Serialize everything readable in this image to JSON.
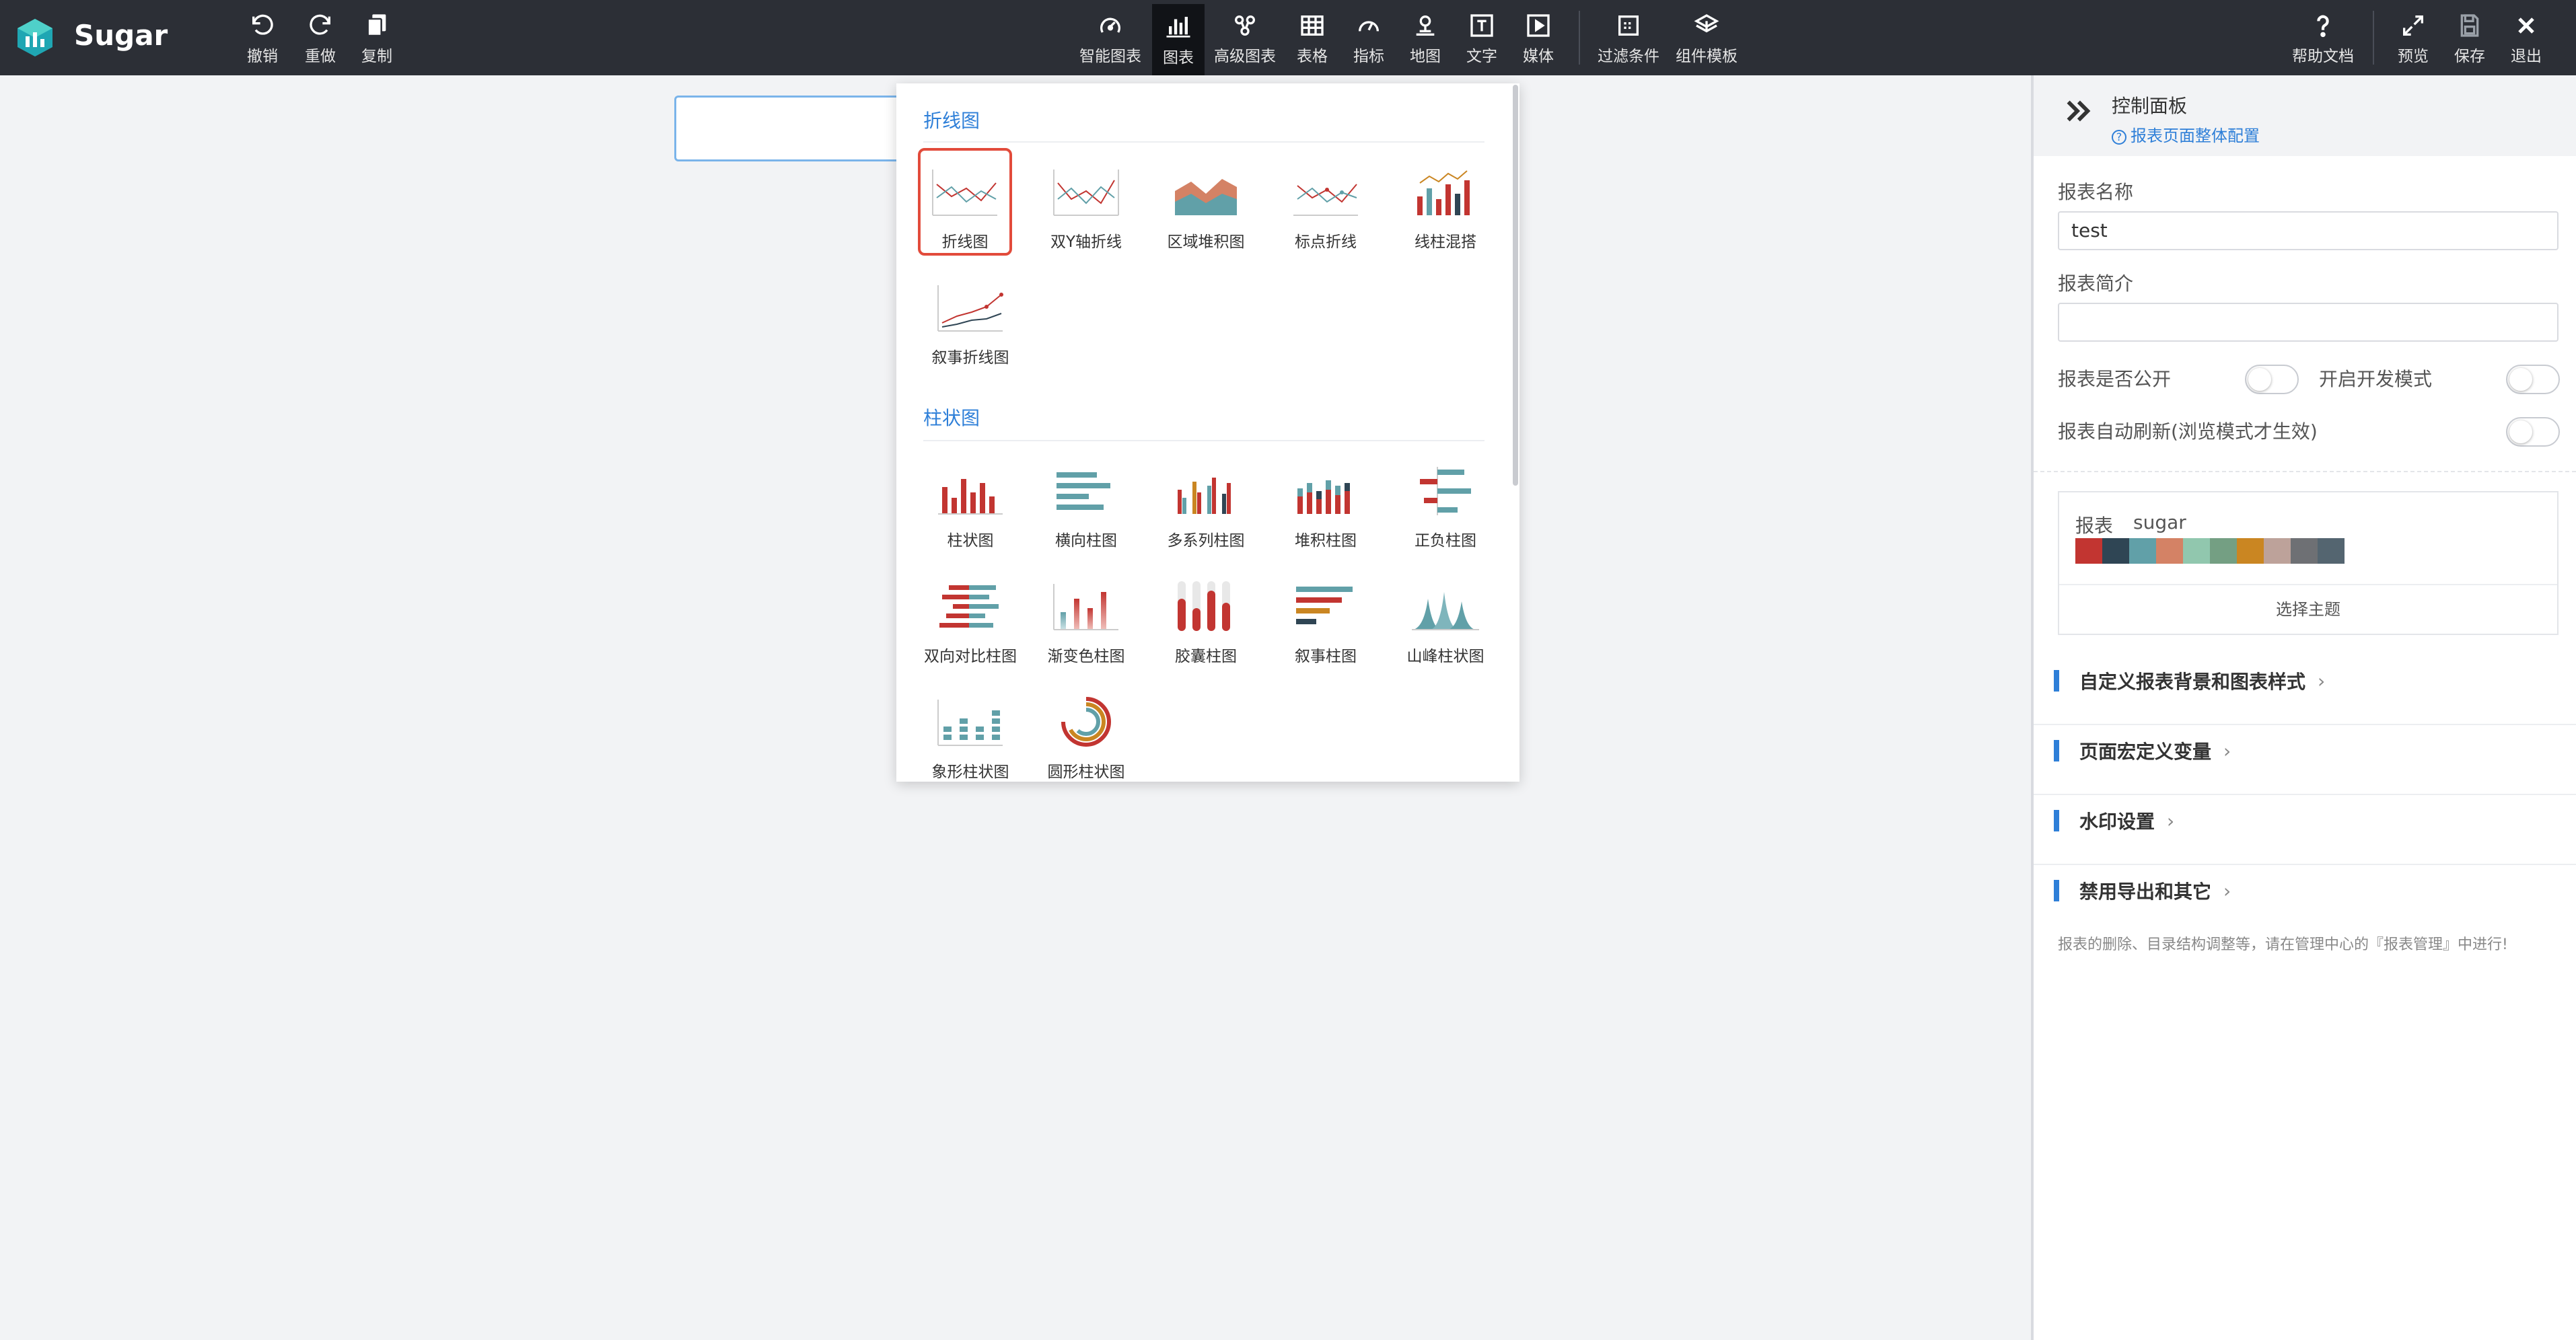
{
  "app": {
    "brand": "Sugar"
  },
  "toolbar": {
    "left": [
      {
        "label": "撤销",
        "icon": "undo-icon"
      },
      {
        "label": "重做",
        "icon": "redo-icon"
      },
      {
        "label": "复制",
        "icon": "copy-icon"
      }
    ],
    "center": [
      {
        "label": "智能图表",
        "icon": "smart-chart-icon"
      },
      {
        "label": "图表",
        "icon": "chart-icon",
        "active": true
      },
      {
        "label": "高级图表",
        "icon": "advanced-chart-icon"
      },
      {
        "label": "表格",
        "icon": "table-icon"
      },
      {
        "label": "指标",
        "icon": "gauge-icon"
      },
      {
        "label": "地图",
        "icon": "map-pin-icon"
      },
      {
        "label": "文字",
        "icon": "text-icon"
      },
      {
        "label": "媒体",
        "icon": "media-icon"
      },
      {
        "label": "过滤条件",
        "icon": "filter-icon"
      },
      {
        "label": "组件模板",
        "icon": "template-icon"
      }
    ],
    "right": [
      {
        "label": "帮助文档",
        "icon": "help-icon"
      },
      {
        "label": "预览",
        "icon": "expand-icon"
      },
      {
        "label": "保存",
        "icon": "save-icon"
      },
      {
        "label": "退出",
        "icon": "close-icon"
      }
    ]
  },
  "chart_menu": {
    "sections": [
      {
        "title": "折线图",
        "items": [
          {
            "label": "折线图",
            "icon": "line-chart-icon",
            "selected": true
          },
          {
            "label": "双Y轴折线",
            "icon": "dual-y-line-icon"
          },
          {
            "label": "区域堆积图",
            "icon": "stacked-area-icon"
          },
          {
            "label": "标点折线",
            "icon": "marker-line-icon"
          },
          {
            "label": "线柱混搭",
            "icon": "line-bar-combo-icon"
          },
          {
            "label": "叙事折线图",
            "icon": "narrative-line-icon"
          }
        ]
      },
      {
        "title": "柱状图",
        "items": [
          {
            "label": "柱状图",
            "icon": "bar-chart-icon"
          },
          {
            "label": "横向柱图",
            "icon": "horizontal-bar-icon"
          },
          {
            "label": "多系列柱图",
            "icon": "multi-series-bar-icon"
          },
          {
            "label": "堆积柱图",
            "icon": "stacked-bar-icon"
          },
          {
            "label": "正负柱图",
            "icon": "pos-neg-bar-icon"
          },
          {
            "label": "双向对比柱图",
            "icon": "bidirectional-bar-icon"
          },
          {
            "label": "渐变色柱图",
            "icon": "gradient-bar-icon"
          },
          {
            "label": "胶囊柱图",
            "icon": "capsule-bar-icon"
          },
          {
            "label": "叙事柱图",
            "icon": "narrative-bar-icon"
          },
          {
            "label": "山峰柱状图",
            "icon": "peak-bar-icon"
          },
          {
            "label": "象形柱状图",
            "icon": "pictorial-bar-icon"
          },
          {
            "label": "圆形柱状图",
            "icon": "radial-bar-icon"
          }
        ]
      }
    ]
  },
  "panel": {
    "title": "控制面板",
    "help_link": "报表页面整体配置",
    "name_label": "报表名称",
    "name_value": "test",
    "desc_label": "报表简介",
    "desc_value": "",
    "public_label": "报表是否公开",
    "dev_label": "开启开发模式",
    "refresh_label": "报表自动刷新(浏览模式才生效)",
    "theme": {
      "label": "报表",
      "name": "sugar",
      "colors": [
        "#c23531",
        "#2f4554",
        "#61a0a8",
        "#d48265",
        "#91c7ae",
        "#749f83",
        "#ca8622",
        "#bda29a",
        "#6e7074",
        "#546570"
      ],
      "button": "选择主题"
    },
    "sections": [
      {
        "label": "自定义报表背景和图表样式"
      },
      {
        "label": "页面宏定义变量"
      },
      {
        "label": "水印设置"
      },
      {
        "label": "禁用导出和其它"
      }
    ],
    "chevron": "›",
    "note": "报表的删除、目录结构调整等，请在管理中心的『报表管理』中进行!"
  }
}
